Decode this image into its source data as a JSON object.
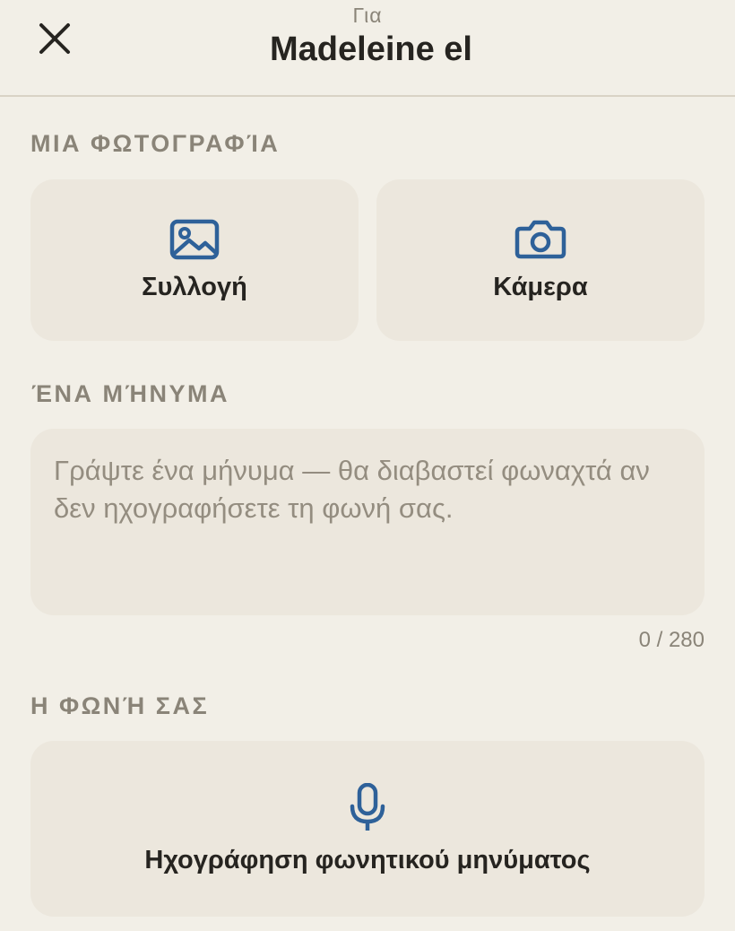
{
  "header": {
    "subtitle": "Για",
    "title": "Madeleine el",
    "close_icon": "close-icon"
  },
  "photo_section": {
    "label": "ΜΙΑ ΦΩΤΟΓΡΑΦΊΑ",
    "gallery": {
      "label": "Συλλογή",
      "icon": "image-icon"
    },
    "camera": {
      "label": "Κάμερα",
      "icon": "camera-icon"
    }
  },
  "message_section": {
    "label": "ΈΝΑ ΜΉΝΥΜΑ",
    "value": "",
    "placeholder": "Γράψτε ένα μήνυμα — θα διαβαστεί φωναχτά αν δεν ηχογραφήσετε τη φωνή σας.",
    "counter": "0 / 280"
  },
  "voice_section": {
    "label": "Η ΦΩΝΉ ΣΑΣ",
    "record": {
      "label": "Ηχογράφηση φωνητικού μηνύματος",
      "icon": "microphone-icon"
    }
  },
  "colors": {
    "background": "#f2efe7",
    "tile": "#ece7dd",
    "accent": "#2e6199",
    "muted_text": "#8a8478",
    "text": "#262420"
  }
}
